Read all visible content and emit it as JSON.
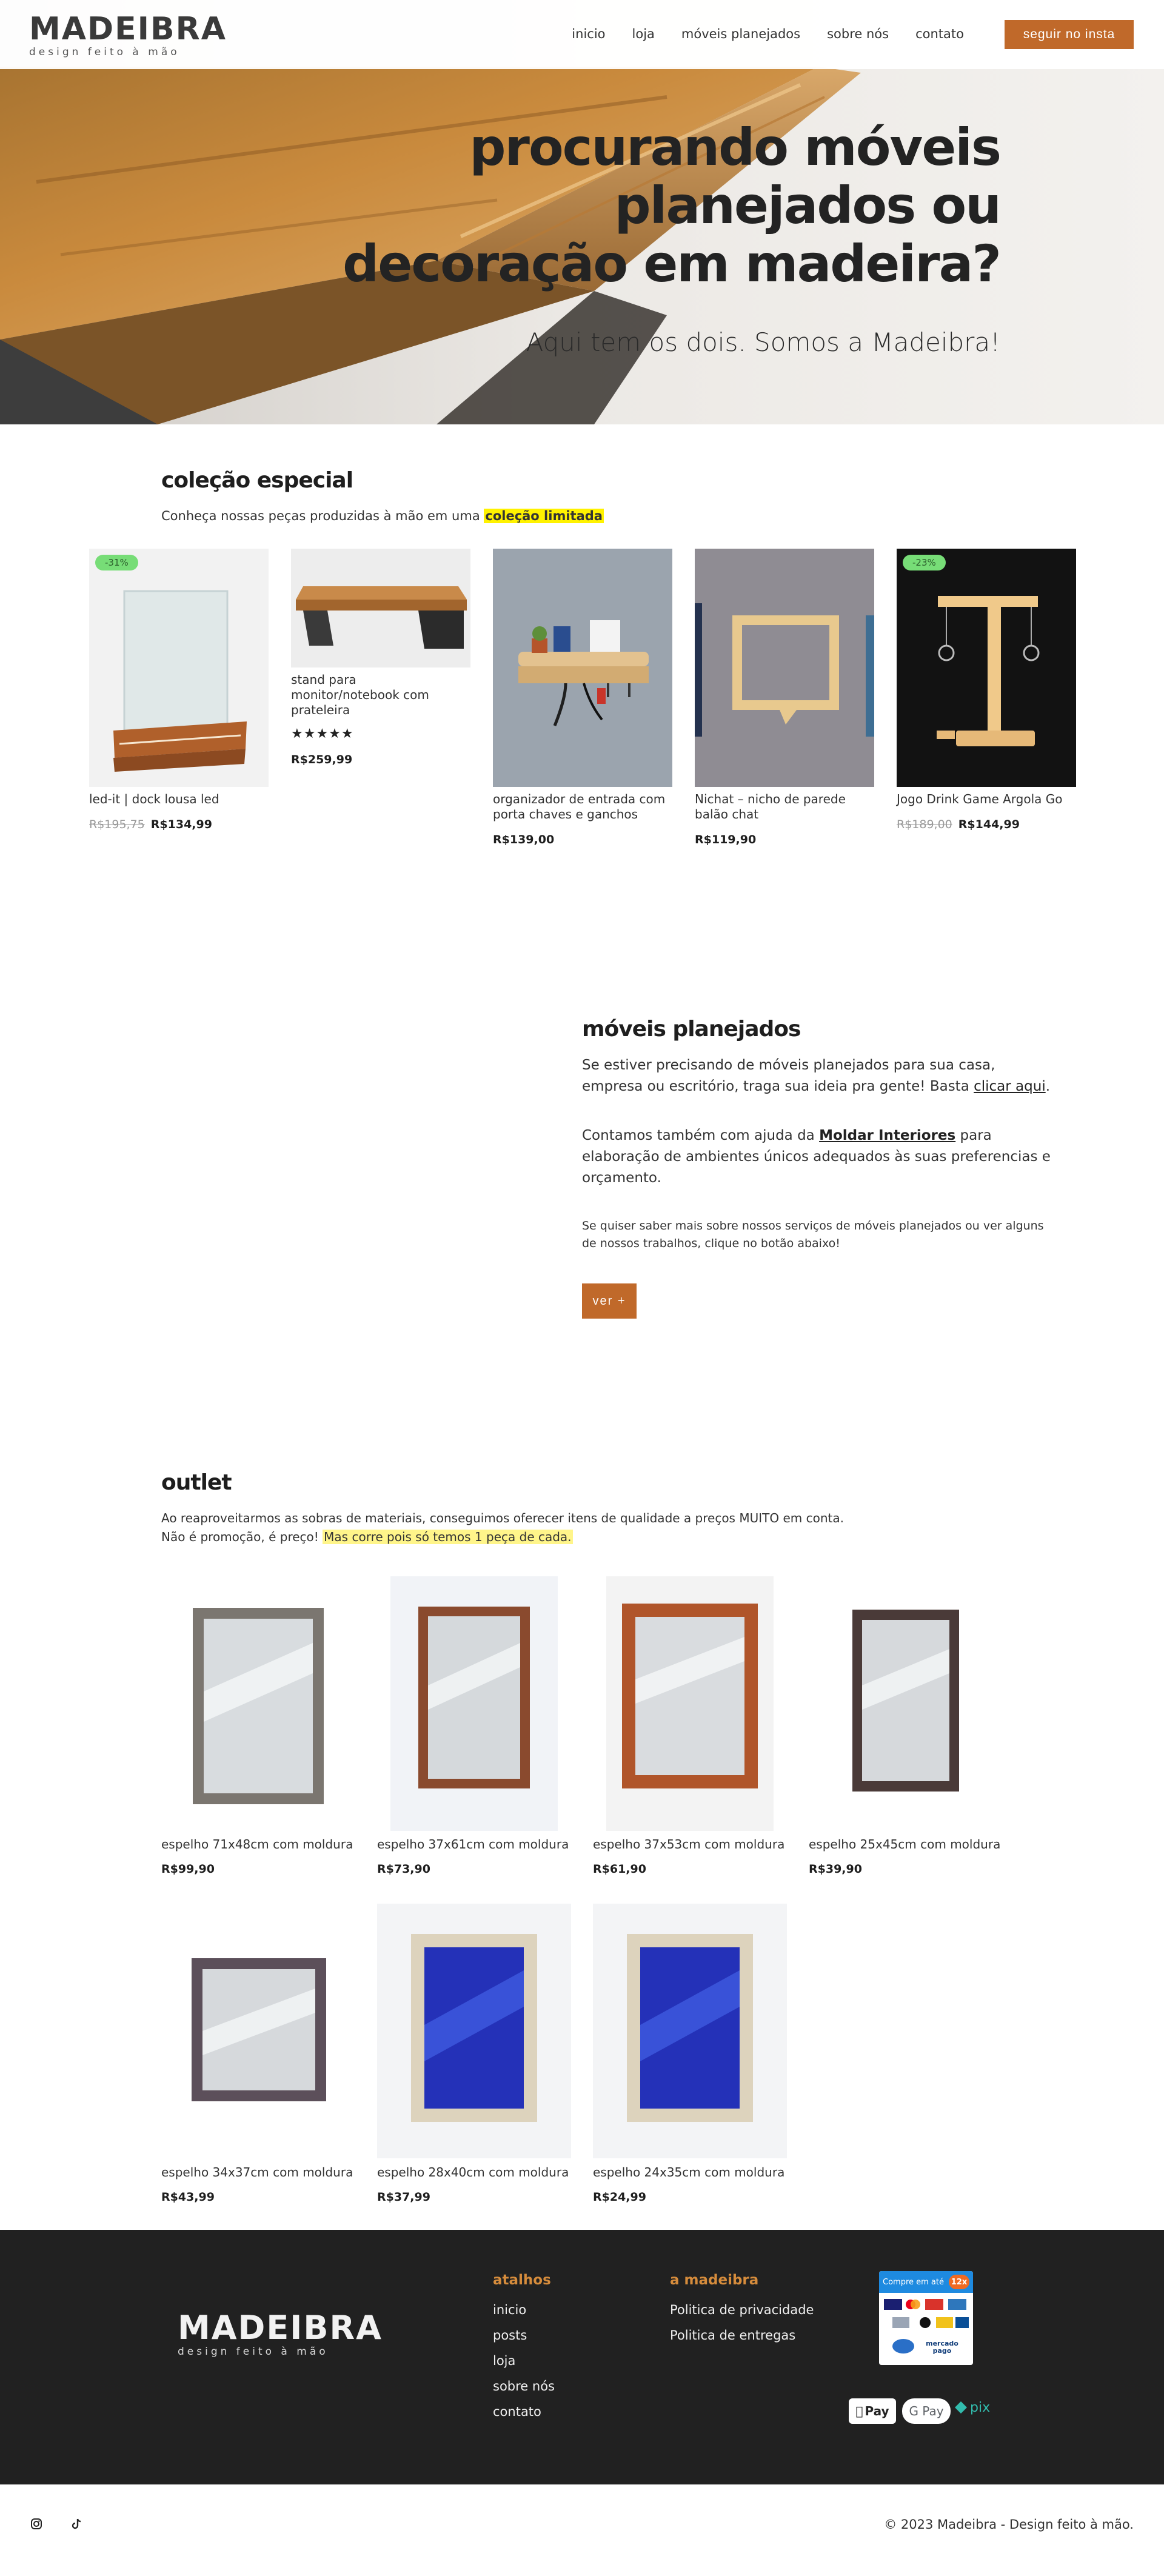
{
  "header": {
    "logo_word": "MADEIBRA",
    "logo_tag": "design feito à mão",
    "nav": [
      "inicio",
      "loja",
      "móveis planejados",
      "sobre nós",
      "contato"
    ],
    "insta_label": "seguir no insta"
  },
  "hero": {
    "title": "procurando móveis planejados ou decoração em madeira?",
    "subtitle": "Aqui tem os dois. Somos a Madeibra!"
  },
  "colecao": {
    "title": "coleção especial",
    "text_pre": "Conheça nossas peças produzidas à mão em uma ",
    "text_hl": "coleção limitada",
    "products": [
      {
        "name": "led-it | dock lousa led",
        "old_price": "R$195,75",
        "price": "R$134,99",
        "badge": "-31%"
      },
      {
        "name": "stand para monitor/notebook com prateleira",
        "price": "R$259,99",
        "rating_stars": 5
      },
      {
        "name": "organizador de entrada com porta chaves e ganchos",
        "price": "R$139,00"
      },
      {
        "name": "Nichat – nicho de parede balão chat",
        "price": "R$119,90"
      },
      {
        "name": "Jogo Drink Game Argola Go",
        "old_price": "R$189,00",
        "price": "R$144,99",
        "badge": "-23%"
      }
    ]
  },
  "moveis": {
    "title": "móveis planejados",
    "p1_pre": "Se estiver precisando de móveis planejados para sua casa, empresa ou escritório, traga sua ideia pra gente! Basta ",
    "p1_link": "clicar aqui",
    "p1_post": ".",
    "p2_pre": "Contamos também com ajuda da ",
    "p2_link": "Moldar Interiores",
    "p2_post": " para elaboração de ambientes únicos adequados às suas preferencias e orçamento.",
    "p3": "Se quiser saber mais sobre nossos serviços de móveis planejados ou ver alguns de nossos trabalhos, clique no botão abaixo!",
    "button": "ver +"
  },
  "outlet": {
    "title": "outlet",
    "line1": "Ao reaproveitarmos as sobras de materiais, conseguimos oferecer itens de qualidade a preços MUITO em conta.",
    "line2_pre": "Não é promoção, é preço! ",
    "line2_hl": "Mas corre pois só temos 1 peça de cada.",
    "products": [
      {
        "name": "espelho 71x48cm com moldura",
        "price": "R$99,90"
      },
      {
        "name": "espelho 37x61cm com moldura",
        "price": "R$73,90"
      },
      {
        "name": "espelho 37x53cm com moldura",
        "price": "R$61,90"
      },
      {
        "name": "espelho 25x45cm com moldura",
        "price": "R$39,90"
      },
      {
        "name": "espelho 34x37cm com moldura",
        "price": "R$43,99"
      },
      {
        "name": "espelho 28x40cm com moldura",
        "price": "R$37,99"
      },
      {
        "name": "espelho 24x35cm com moldura",
        "price": "R$24,99"
      }
    ]
  },
  "footer": {
    "atalhos_title": "atalhos",
    "atalhos": [
      "inicio",
      "posts",
      "loja",
      "sobre nós",
      "contato"
    ],
    "madeibra_title": "a madeibra",
    "madeibra_links": [
      "Politica de privacidade",
      "Politica de entregas"
    ],
    "pay_card_header": "Compre em até",
    "pay_card_badge": "12x",
    "pay_card_mercado": "mercado pago",
    "pay_pills": [
      "Pay",
      "G Pay",
      "pix"
    ],
    "copyright": "© 2023 Madeibra - Design feito à mão."
  },
  "colors": {
    "accent": "#c0692a",
    "footer_bg": "#212121",
    "footer_title": "#d68c3c",
    "highlight": "#fff200",
    "badge": "#77dd77"
  }
}
